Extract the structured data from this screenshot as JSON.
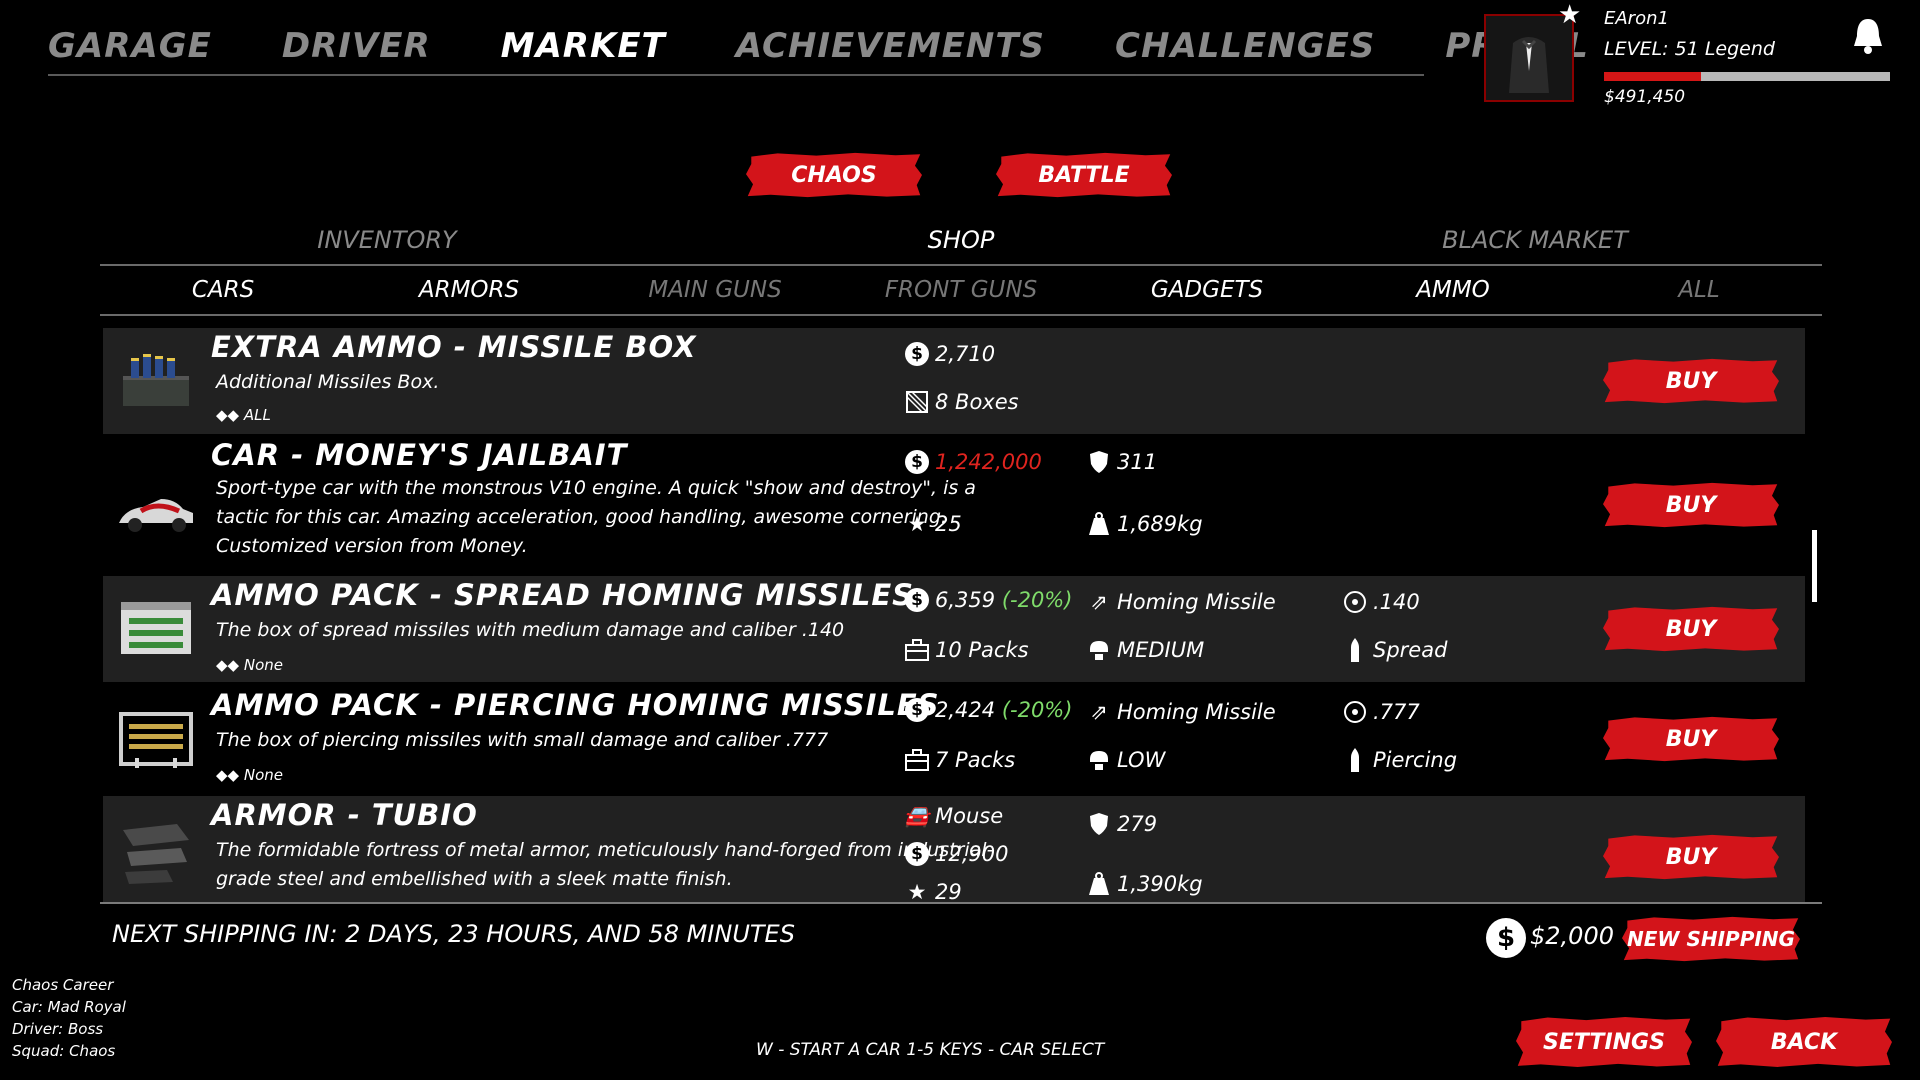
{
  "nav": [
    "GARAGE",
    "DRIVER",
    "MARKET",
    "ACHIEVEMENTS",
    "CHALLENGES",
    "PROFIL"
  ],
  "profile": {
    "name": "EAron1",
    "level": "LEVEL: 51 Legend",
    "money": "$491,450",
    "xp_progress": 0.34
  },
  "modes": {
    "chaos": "CHAOS",
    "battle": "BATTLE"
  },
  "sections": [
    "INVENTORY",
    "SHOP",
    "BLACK MARKET"
  ],
  "categories": [
    "CARS",
    "ARMORS",
    "MAIN GUNS",
    "FRONT GUNS",
    "GADGETS",
    "AMMO",
    "ALL"
  ],
  "items": [
    {
      "title": "EXTRA AMMO - MISSILE BOX",
      "desc": "Additional Missiles Box.",
      "compat": "ALL",
      "price": "2,710",
      "qty": "8 Boxes",
      "buy": "BUY"
    },
    {
      "title": "CAR - MONEY'S JAILBAIT",
      "desc": "Sport-type car with the monstrous V10 engine. A quick \"show and destroy\", is a tactic for this car. Amazing acceleration, good handling, awesome cornering. Customized version from Money.",
      "price": "1,242,000",
      "rating": "25",
      "armor": "311",
      "weight": "1,689kg",
      "buy": "BUY"
    },
    {
      "title": "AMMO PACK - SPREAD HOMING MISSILES",
      "desc": "The box of spread missiles with medium damage and caliber .140",
      "compat": "None",
      "price": "6,359",
      "discount": "(-20%)",
      "qty": "10 Packs",
      "type": "Homing Missile",
      "damage": "MEDIUM",
      "caliber": ".140",
      "mode": "Spread",
      "buy": "BUY"
    },
    {
      "title": "AMMO PACK - PIERCING HOMING MISSILES",
      "desc": "The box of piercing missiles with small damage and caliber .777",
      "compat": "None",
      "price": "2,424",
      "discount": "(-20%)",
      "qty": "7 Packs",
      "type": "Homing Missile",
      "damage": "LOW",
      "caliber": ".777",
      "mode": "Piercing",
      "buy": "BUY"
    },
    {
      "title": "ARMOR - TUBIO",
      "desc": "The formidable fortress of metal armor, meticulously hand-forged from industrial-grade steel and embellished with a sleek matte finish.",
      "car": "Mouse",
      "price": "12,900",
      "rating": "29",
      "armor": "279",
      "weight": "1,390kg",
      "buy": "BUY"
    }
  ],
  "shipping": {
    "text": "NEXT SHIPPING IN: 2 DAYS, 23 HOURS, AND 58 MINUTES",
    "cost": "$2,000",
    "button": "NEW SHIPPING"
  },
  "career": {
    "line1": "Chaos Career",
    "line2": "Car: Mad Royal",
    "line3": "Driver: Boss",
    "line4": "Squad: Chaos"
  },
  "hint": "W - START A CAR    1-5 KEYS - CAR SELECT",
  "buttons": {
    "settings": "SETTINGS",
    "back": "BACK"
  },
  "colors": {
    "accent": "#d3141a",
    "discount": "#7fdc6a",
    "price_red": "#e0241f"
  }
}
